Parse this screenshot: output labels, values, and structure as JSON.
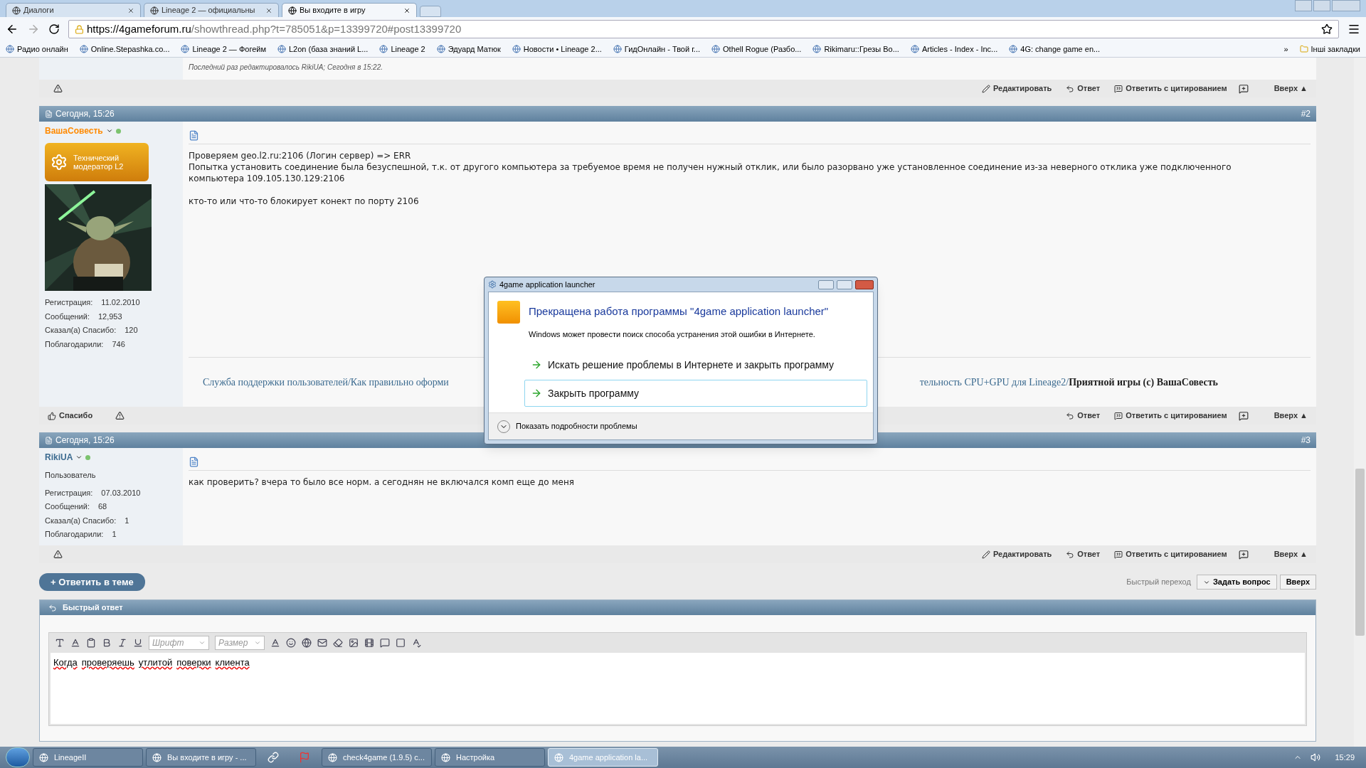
{
  "browser": {
    "tabs": [
      {
        "title": "Диалоги",
        "selected": false
      },
      {
        "title": "Lineage 2 — официальны",
        "selected": false
      },
      {
        "title": "Вы входите в игру",
        "selected": true
      }
    ],
    "url": {
      "host": "https://4gameforum.ru",
      "path": "/showthread.php?t=785051&p=13399720#post13399720"
    },
    "bookmarks": [
      "Радио онлайн",
      "Online.Stepashka.co...",
      "Lineage 2 — Фогейм",
      "L2on (база знаний L...",
      "Lineage 2",
      "Эдуард Матюк",
      "Новости • Lineage 2...",
      "ГидОнлайн - Твой г...",
      "Othell Rogue (Разбо...",
      "Rikimaru::Грезы Во...",
      "Articles - Index - Inc...",
      "4G: change game en..."
    ],
    "overflow": "»",
    "other_bookmarks": "Інші закладки"
  },
  "edited_note": "Последний раз редактировалось RikiUA; Сегодня в 15:22.",
  "top_actions": [
    "Редактировать",
    "Ответ",
    "Ответить с цитированием",
    "Вверх ▲"
  ],
  "posts": [
    {
      "date": "Сегодня, 15:26",
      "number": "#2",
      "author": "ВашаСовесть",
      "color": "#ff8a00",
      "badge": "Технический модератор L2",
      "avatar": {
        "kind": "picture"
      },
      "stats": [
        {
          "label": "Регистрация:",
          "value": "11.02.2010"
        },
        {
          "label": "Сообщений:",
          "value": "12,953"
        },
        {
          "label": "Сказал(а) Спасибо:",
          "value": "120"
        },
        {
          "label": "Поблагодарили:",
          "value": "746"
        }
      ],
      "paragraphs": [
        [
          "Проверяем geo.l2.ru:2106 (Логин сервер) => ERR",
          "Попытка установить соединение была безуспешной, т.к. от другого компьютера за требуемое время не получен нужный отклик, или было разорвано уже установленное соединение из-за неверного отклика уже подключенного компьютера 109.105.130.129:2106"
        ],
        [
          "кто-то или что-то блокирует конект по порту 2106"
        ]
      ],
      "signature": {
        "left": "Служба поддержки пользователей/Как правильно оформи",
        "right": "тельность CPU+GPU для Lineage2/",
        "bold": "Приятной игры (с) ВашаСовесть"
      },
      "thanks": "Спасибо",
      "actions": [
        "Ответ",
        "Ответить с цитированием",
        "Вверх ▲"
      ]
    },
    {
      "date": "Сегодня, 15:26",
      "number": "#3",
      "author": "RikiUA",
      "color": "#3b6a8f",
      "role": "Пользователь",
      "stats": [
        {
          "label": "Регистрация:",
          "value": "07.03.2010"
        },
        {
          "label": "Сообщений:",
          "value": "68"
        },
        {
          "label": "Сказал(а) Спасибо:",
          "value": "1"
        },
        {
          "label": "Поблагодарили:",
          "value": "1"
        }
      ],
      "paragraphs": [
        [
          "как проверить? вчера то было все норм. а сегоднян не включался комп еще до меня"
        ]
      ],
      "actions": [
        "Редактировать",
        "Ответ",
        "Ответить с цитированием",
        "Вверх ▲"
      ]
    }
  ],
  "reply_button": "+ Ответить в теме",
  "quick_nav": {
    "label": "Быстрый переход",
    "buttons": [
      "Задать вопрос",
      "Вверх"
    ]
  },
  "quick_reply": {
    "title": "Быстрый ответ",
    "font": "Шрифт",
    "size": "Размер",
    "words": [
      "Когда",
      "проверяешь",
      "утлитой",
      "поверки",
      "клиента"
    ]
  },
  "dialog": {
    "title": "4game application launcher",
    "heading": "Прекращена работа программы \"4game application launcher\"",
    "message": "Windows может провести поиск способа устранения этой ошибки в Интернете.",
    "options": [
      {
        "label": "Искать решение проблемы в Интернете и закрыть программу",
        "selected": false
      },
      {
        "label": "Закрыть программу",
        "selected": true
      }
    ],
    "details": "Показать подробности проблемы"
  },
  "taskbar": {
    "items": [
      {
        "label": "LineageII",
        "selected": false
      },
      {
        "label": "Вы входите в игру - ...",
        "selected": false
      },
      {
        "label": "check4game (1.9.5) c...",
        "selected": false
      },
      {
        "label": "Настройка",
        "selected": false
      },
      {
        "label": "4game application la...",
        "selected": true
      }
    ],
    "clock": "15:29"
  }
}
